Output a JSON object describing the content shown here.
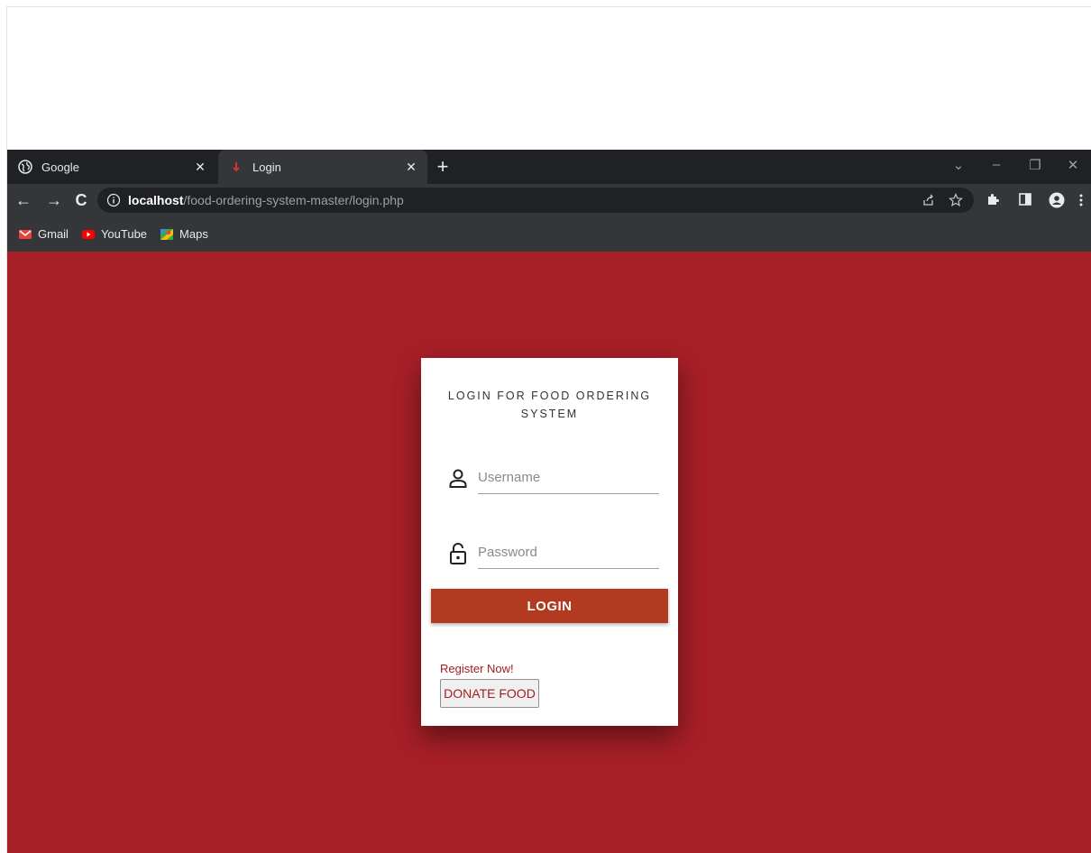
{
  "browser": {
    "tabs": [
      {
        "title": "Google",
        "close": "✕"
      },
      {
        "title": "Login",
        "close": "✕"
      }
    ],
    "new_tab": "+",
    "window_controls": {
      "dropdown": "⌄",
      "minimize": "–",
      "restore": "❐",
      "close": "✕"
    },
    "nav": {
      "back": "←",
      "forward": "→",
      "reload": "C"
    },
    "url": {
      "host": "localhost",
      "path": "/food-ordering-system-master/login.php"
    },
    "bookmarks": [
      "Gmail",
      "YouTube",
      "Maps"
    ],
    "colors": {
      "tabstrip": "#202124",
      "toolbar": "#35363a",
      "omnibox": "#202124"
    }
  },
  "page": {
    "background": "#a71f27",
    "title": "LOGIN FOR FOOD ORDERING SYSTEM",
    "username_placeholder": "Username",
    "password_placeholder": "Password",
    "login_label": "LOGIN",
    "register_label": "Register Now!",
    "donate_label": "DONATE FOOD",
    "colors": {
      "login_button": "#b23a21",
      "link": "#a02020"
    }
  }
}
